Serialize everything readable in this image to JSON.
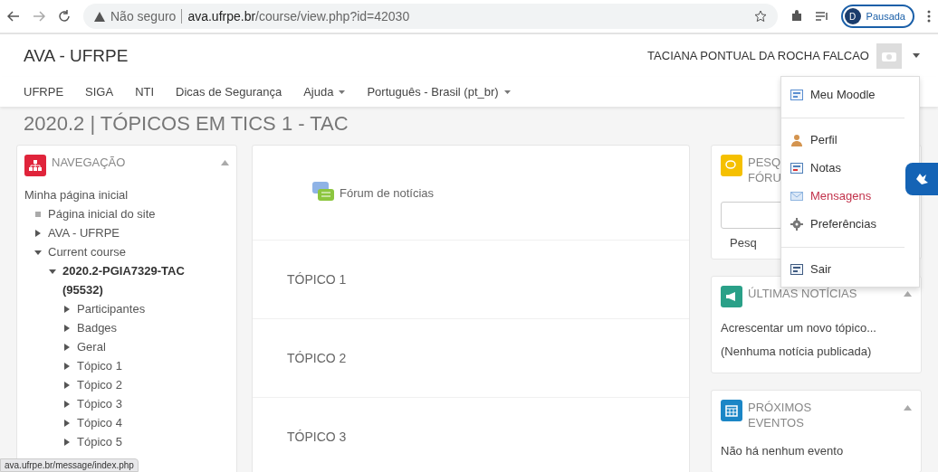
{
  "browser": {
    "security": "Não seguro",
    "url": "**ava.ufrpe.br**/course/view.php?id=42030",
    "profile_initial": "D",
    "profile_status": "Pausada"
  },
  "site": {
    "title": "AVA - UFRPE",
    "user": "TACIANA PONTUAL DA ROCHA FALCAO"
  },
  "menu": [
    {
      "label": "UFRPE",
      "has_dropdown": false
    },
    {
      "label": "SIGA",
      "has_dropdown": false
    },
    {
      "label": "NTI",
      "has_dropdown": false
    },
    {
      "label": "Dicas de Segurança",
      "has_dropdown": false
    },
    {
      "label": "Ajuda",
      "has_dropdown": true
    },
    {
      "label": "Português - Brasil (pt_br)",
      "has_dropdown": true
    }
  ],
  "page_title": "2020.2 | TÓPICOS EM TICS 1 - TAC",
  "navigation": {
    "title": "NAVEGAÇÃO",
    "expanded": true,
    "tree": [
      {
        "label": "Minha página inicial",
        "kind": "root",
        "children": [
          {
            "label": "Página inicial do site",
            "kind": "leaf"
          },
          {
            "label": "AVA - UFRPE",
            "kind": "branch",
            "expanded": false
          },
          {
            "label": "Current course",
            "kind": "branch",
            "expanded": true,
            "children": [
              {
                "label": "2020.2-PGIA7329-TAC (95532)",
                "kind": "branch",
                "expanded": true,
                "current": true,
                "children": [
                  {
                    "label": "Participantes",
                    "kind": "branch",
                    "expanded": false
                  },
                  {
                    "label": "Badges",
                    "kind": "branch",
                    "expanded": false
                  },
                  {
                    "label": "Geral",
                    "kind": "branch",
                    "expanded": false
                  },
                  {
                    "label": "Tópico 1",
                    "kind": "branch",
                    "expanded": false
                  },
                  {
                    "label": "Tópico 2",
                    "kind": "branch",
                    "expanded": false
                  },
                  {
                    "label": "Tópico 3",
                    "kind": "branch",
                    "expanded": false
                  },
                  {
                    "label": "Tópico 4",
                    "kind": "branch",
                    "expanded": false
                  },
                  {
                    "label": "Tópico 5",
                    "kind": "branch",
                    "expanded": false
                  }
                ]
              }
            ]
          }
        ]
      }
    ]
  },
  "sections": [
    {
      "kind": "forum",
      "label": "Fórum de notícias"
    },
    {
      "kind": "topic",
      "label": "TÓPICO 1"
    },
    {
      "kind": "topic",
      "label": "TÓPICO 2"
    },
    {
      "kind": "topic",
      "label": "TÓPICO 3"
    }
  ],
  "blocks": [
    {
      "kind": "search",
      "title": "PESQ\nFÓRU",
      "button": "Pesq"
    },
    {
      "kind": "news",
      "title": "ÚLTIMAS NOTÍCIAS",
      "expanded": true,
      "lines": [
        "Acrescentar um novo tópico...",
        "(Nenhuma notícia publicada)"
      ]
    },
    {
      "kind": "events",
      "title": "PRÓXIMOS EVENTOS",
      "expanded": true,
      "lines": [
        "Não há nenhum evento"
      ]
    }
  ],
  "user_menu": {
    "open": true,
    "items": [
      {
        "kind": "dashboard",
        "label": "Meu Moodle",
        "selected": false,
        "divider_before": false
      },
      {
        "kind": "profile",
        "label": "Perfil",
        "selected": false,
        "divider_before": true
      },
      {
        "kind": "grades",
        "label": "Notas",
        "selected": false,
        "divider_before": false
      },
      {
        "kind": "messages",
        "label": "Mensagens",
        "selected": true,
        "divider_before": false
      },
      {
        "kind": "preferences",
        "label": "Preferências",
        "selected": false,
        "divider_before": false
      },
      {
        "kind": "logout",
        "label": "Sair",
        "selected": false,
        "divider_before": true
      }
    ]
  },
  "status_url": "ava.ufrpe.br/message/index.php"
}
